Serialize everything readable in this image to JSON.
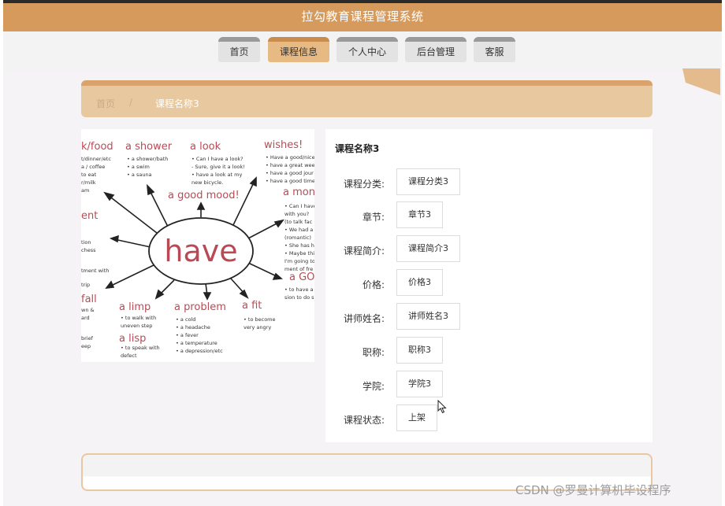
{
  "header": {
    "title": "拉勾教育课程管理系统"
  },
  "nav": {
    "items": [
      {
        "label": "首页"
      },
      {
        "label": "课程信息"
      },
      {
        "label": "个人中心"
      },
      {
        "label": "后台管理"
      },
      {
        "label": "客服"
      }
    ],
    "active_index": 1
  },
  "breadcrumb": {
    "home": "首页",
    "separator": "/",
    "current": "课程名称3"
  },
  "image": {
    "center_word": "have",
    "phrases": [
      "k/food",
      "a shower",
      "a look",
      "wishes!",
      "a good mood!",
      "a mon",
      "ent",
      "a GO!",
      "fall",
      "a limp",
      "a problem",
      "a fit",
      "a lisp"
    ],
    "notes": {
      "food": [
        "t/dinner/etc",
        "a / coffee",
        "to eat",
        "r/milk",
        "am"
      ],
      "shower": [
        "• a shower/bath",
        "• a swim",
        "• a sauna"
      ],
      "look": [
        "• Can I have a look?",
        "- Sure, give it a look!",
        "• have a look at my",
        "new bicycle."
      ],
      "wishes": [
        "• Have a good/nice",
        "• have a great wee",
        "• have a good jour",
        "• have a good time"
      ],
      "mon": [
        "• Can I have",
        "with you?",
        "(to talk fac",
        "• We had a",
        "(romantic)",
        "• She has he",
        "• Maybe thi",
        "I'm going to",
        "ment of fre"
      ],
      "ent": [
        "tion",
        "chess"
      ],
      "go": [
        "• to have a g",
        "sion to do s"
      ],
      "fall": [
        "tment with",
        "trip",
        "wn &",
        "ard",
        "brief",
        "eep"
      ],
      "limp": [
        "• to walk with",
        "uneven step"
      ],
      "lisp": [
        "• to speak with",
        "defect"
      ],
      "problem": [
        "• a cold",
        "• a headache",
        "• a fever",
        "• a temperature",
        "• a depression/etc"
      ],
      "fit": [
        "• to become",
        "very angry"
      ]
    }
  },
  "course": {
    "title": "课程名称3",
    "fields": [
      {
        "label": "课程分类:",
        "value": "课程分类3"
      },
      {
        "label": "章节:",
        "value": "章节3"
      },
      {
        "label": "课程简介:",
        "value": "课程简介3"
      },
      {
        "label": "价格:",
        "value": "价格3"
      },
      {
        "label": "讲师姓名:",
        "value": "讲师姓名3"
      },
      {
        "label": "职称:",
        "value": "职称3"
      },
      {
        "label": "学院:",
        "value": "学院3"
      },
      {
        "label": "课程状态:",
        "value": "上架"
      }
    ]
  },
  "watermark": {
    "text": "CSDN @罗曼计算机毕设程序"
  },
  "colors": {
    "header": "#d69b5c",
    "accent": "#e7b983",
    "breadcrumb": "#e8c89f"
  }
}
